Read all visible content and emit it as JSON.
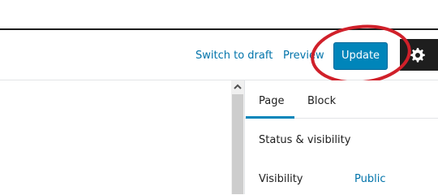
{
  "header": {
    "switch_to_draft_label": "Switch to draft",
    "preview_label": "Preview",
    "update_label": "Update",
    "settings_icon": "gear-icon"
  },
  "sidebar": {
    "tabs": [
      {
        "label": "Page",
        "active": true
      },
      {
        "label": "Block",
        "active": false
      }
    ],
    "panel": {
      "title": "Status & visibility",
      "rows": [
        {
          "label": "Visibility",
          "value": "Public"
        }
      ]
    }
  },
  "colors": {
    "accent": "#0085ba",
    "link": "#0073aa",
    "annotation": "#d0202a",
    "settings_bg": "#1e1e1e"
  }
}
